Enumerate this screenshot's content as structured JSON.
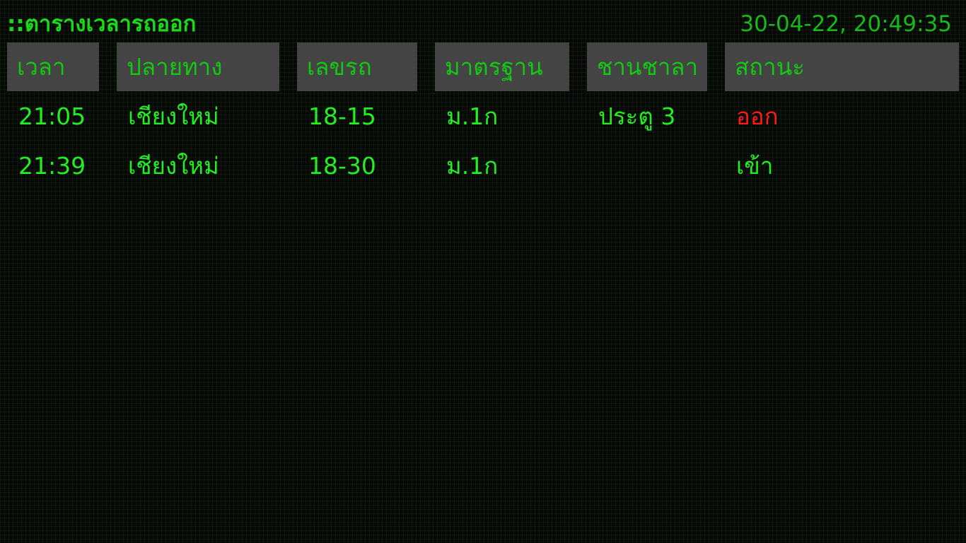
{
  "header": {
    "title": "::ตารางเวลารถออก",
    "clock": "30-04-22, 20:49:35"
  },
  "columns": {
    "time": "เวลา",
    "destination": "ปลายทาง",
    "train_no": "เลขรถ",
    "standard": "มาตรฐาน",
    "platform": "ชานชาลา",
    "status": "สถานะ"
  },
  "rows": [
    {
      "time": "21:05",
      "destination": "เชียงใหม่",
      "train_no": "18-15",
      "standard": "ม.1ก",
      "platform": "ประตู 3",
      "status": "ออก",
      "status_color": "#ff1a1a"
    },
    {
      "time": "21:39",
      "destination": "เชียงใหม่",
      "train_no": "18-30",
      "standard": "ม.1ก",
      "platform": "",
      "status": "เข้า",
      "status_color": "#22ee22"
    }
  ],
  "colors": {
    "background": "#050805",
    "text_green": "#22ee22",
    "header_bg": "#444444",
    "status_departed": "#ff1a1a"
  }
}
